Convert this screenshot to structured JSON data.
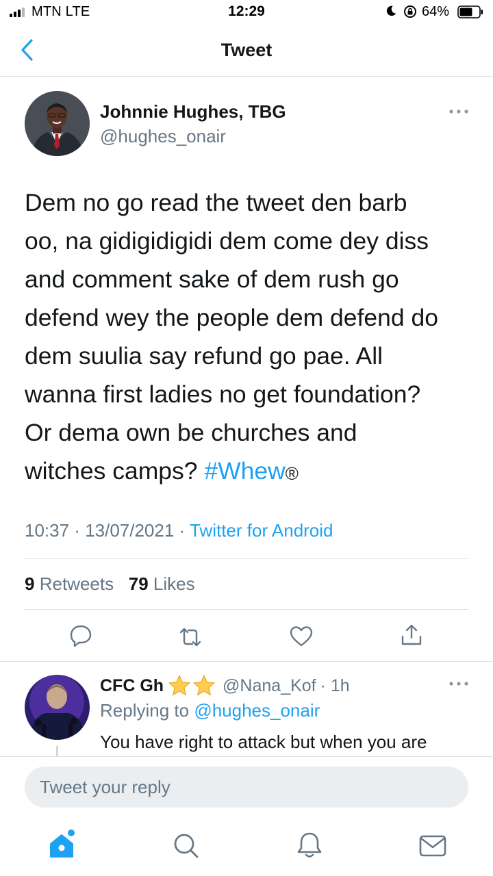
{
  "status_bar": {
    "carrier": "MTN  LTE",
    "time": "12:29",
    "battery": "64%"
  },
  "nav": {
    "title": "Tweet",
    "back_icon": "chevron-left-icon"
  },
  "tweet": {
    "author_name": "Johnnie Hughes, TBG",
    "author_handle": "@hughes_onair",
    "text_lines": [
      "Dem no go read the tweet den barb",
      "oo, na gidigidigidi dem come dey diss",
      "and comment sake of dem rush go",
      "defend wey the people dem defend do",
      "dem suulia say refund go pae. All",
      "wanna first ladies no get foundation?",
      "Or dema own be churches and",
      "witches camps? "
    ],
    "hashtag": "#Whew",
    "trailing": "®",
    "time": "10:37",
    "separator": " · ",
    "date": "13/07/2021",
    "source": "Twitter for Android",
    "retweet_count": "9",
    "retweet_label": "Retweets",
    "like_count": "79",
    "like_label": "Likes",
    "actions": [
      "reply-icon",
      "retweet-icon",
      "like-icon",
      "share-icon"
    ]
  },
  "reply": {
    "name": "CFC Gh",
    "handle": "@Nana_Kof",
    "age": "· 1h",
    "replying_prefix": "Replying to ",
    "replying_to": "@hughes_onair",
    "text": "You have right to attack but when you are"
  },
  "composer": {
    "placeholder": "Tweet your reply"
  },
  "tab_bar": [
    "home-icon",
    "search-icon",
    "notifications-icon",
    "messages-icon"
  ],
  "colors": {
    "accent": "#1da1f2",
    "secondary_text": "#657786",
    "primary_text": "#14171a",
    "star": "#ffcc4d"
  }
}
